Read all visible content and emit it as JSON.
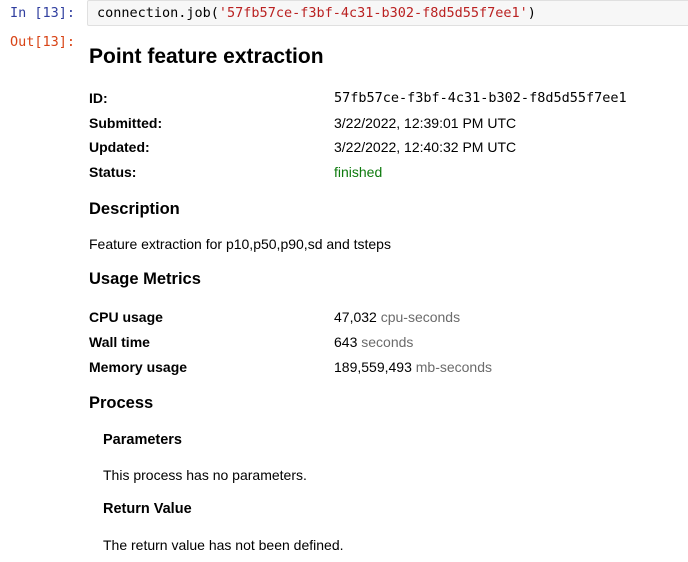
{
  "input_cell": {
    "prompt": "In [13]:",
    "code_prefix": "connection.job(",
    "code_string": "'57fb57ce-f3bf-4c31-b302-f8d5d55f7ee1'",
    "code_suffix": ")"
  },
  "output_cell": {
    "prompt": "Out[13]:",
    "title": "Point feature extraction",
    "meta": [
      {
        "label": "ID:",
        "value": "57fb57ce-f3bf-4c31-b302-f8d5d55f7ee1"
      },
      {
        "label": "Submitted:",
        "value": "3/22/2022, 12:39:01 PM UTC"
      },
      {
        "label": "Updated:",
        "value": "3/22/2022, 12:40:32 PM UTC"
      },
      {
        "label": "Status:",
        "value": "finished"
      }
    ],
    "description_heading": "Description",
    "description_text": "Feature extraction for p10,p50,p90,sd and tsteps",
    "usage_heading": "Usage Metrics",
    "usage": [
      {
        "label": "CPU usage",
        "value": "47,032",
        "unit": "cpu-seconds"
      },
      {
        "label": "Wall time",
        "value": "643",
        "unit": "seconds"
      },
      {
        "label": "Memory usage",
        "value": "189,559,493",
        "unit": "mb-seconds"
      }
    ],
    "process_heading": "Process",
    "parameters_heading": "Parameters",
    "parameters_text": "This process has no parameters.",
    "return_heading": "Return Value",
    "return_text": "The return value has not been defined."
  },
  "colors": {
    "in_prompt": "#303f9f",
    "out_prompt": "#d84315",
    "string_literal": "#ba2121",
    "status_finished": "#0d7a0d",
    "unit_text": "#6b6b6b"
  }
}
